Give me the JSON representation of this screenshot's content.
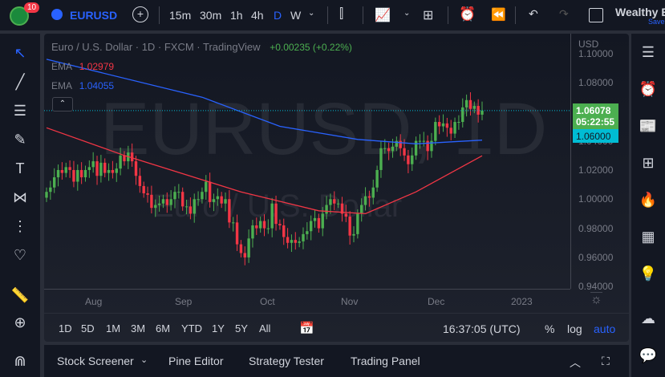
{
  "toolbar": {
    "badge": "10",
    "symbol": "EURUSD",
    "intervals": [
      "15m",
      "30m",
      "1h",
      "4h",
      "D",
      "W"
    ],
    "account": "Wealthy E",
    "save": "Save"
  },
  "legend": {
    "title": "Euro / U.S. Dollar · 1D · FXCM · TradingView",
    "change": "+0.00235 (+0.22%)",
    "ema1_label": "EMA",
    "ema1_value": "1.02979",
    "ema2_label": "EMA",
    "ema2_value": "1.04055"
  },
  "watermark": {
    "symbol": "EURUSD, 1D",
    "name": "Euro / U.S. Dollar"
  },
  "price_axis": {
    "currency": "USD",
    "ticks": [
      "1.10000",
      "1.08000",
      "1.06000",
      "1.04000",
      "1.02000",
      "1.00000",
      "0.98000",
      "0.96000",
      "0.94000"
    ],
    "last_price": "1.06078",
    "countdown": "05:22:55",
    "line_price": "1.06000"
  },
  "time_axis": [
    "Aug",
    "Sep",
    "Oct",
    "Nov",
    "Dec",
    "2023"
  ],
  "timeframes": [
    "1D",
    "5D",
    "1M",
    "3M",
    "6M",
    "YTD",
    "1Y",
    "5Y",
    "All"
  ],
  "clock": "16:37:05 (UTC)",
  "scale": {
    "pct": "%",
    "log": "log",
    "auto": "auto"
  },
  "panels": [
    "Stock Screener",
    "Pine Editor",
    "Strategy Tester",
    "Trading Panel"
  ],
  "colors": {
    "up": "#4caf50",
    "down": "#f23645",
    "ema_red": "#f23645",
    "ema_blue": "#2962ff",
    "accent": "#2962ff"
  },
  "chart_data": {
    "type": "candlestick",
    "ylim": [
      0.94,
      1.1
    ],
    "last": 1.06078,
    "closes": [
      1.005,
      1.008,
      1.015,
      1.02,
      1.018,
      1.022,
      1.02,
      1.012,
      1.02,
      1.015,
      1.02,
      1.022,
      1.026,
      1.016,
      1.025,
      1.018,
      1.02,
      1.018,
      1.021,
      1.03,
      1.026,
      1.032,
      1.026,
      1.016,
      1.009,
      1.004,
      1.003,
      0.994,
      0.996,
      0.997,
      1.0,
      0.996,
      1.0,
      1.005,
      1.005,
      0.995,
      0.995,
      0.99,
      1.0,
      1.0,
      1.005,
      1.012,
      0.998,
      1.0,
      1.002,
      0.997,
      1.0,
      0.984,
      0.984,
      0.969,
      0.963,
      0.96,
      0.973,
      0.982,
      0.98,
      0.985,
      0.98,
      0.98,
      0.997,
      0.983,
      0.982,
      0.974,
      0.97,
      0.972,
      0.97,
      0.971,
      0.976,
      0.978,
      0.985,
      0.987,
      0.98,
      0.99,
      0.996,
      1.0,
      0.997,
      0.997,
      0.99,
      0.988,
      0.975,
      0.976,
      0.99,
      0.996,
      1.002,
      1.001,
      1.008,
      1.02,
      1.035,
      1.035,
      1.033,
      1.036,
      1.04,
      1.035,
      1.03,
      1.024,
      1.03,
      1.04,
      1.04,
      1.04,
      1.033,
      1.04,
      1.053,
      1.05,
      1.052,
      1.049,
      1.045,
      1.053,
      1.053,
      1.063,
      1.068,
      1.062,
      1.064,
      1.058,
      1.0608
    ],
    "ema_red": [
      [
        0,
        1.049
      ],
      [
        20,
        1.03
      ],
      [
        50,
        1.005
      ],
      [
        70,
        0.992
      ],
      [
        82,
        0.99
      ],
      [
        95,
        1.005
      ],
      [
        112,
        1.0298
      ]
    ],
    "ema_blue": [
      [
        0,
        1.096
      ],
      [
        40,
        1.07
      ],
      [
        60,
        1.05
      ],
      [
        80,
        1.041
      ],
      [
        95,
        1.038
      ],
      [
        112,
        1.0405
      ]
    ]
  }
}
